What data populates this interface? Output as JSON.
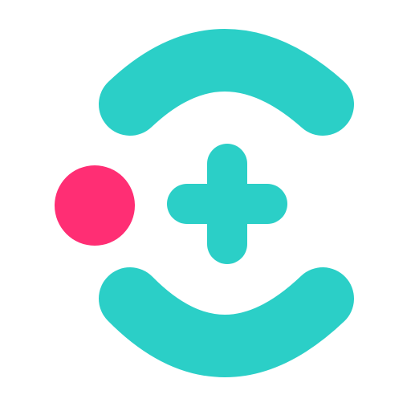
{
  "logo": {
    "name": "medical-app-logo",
    "colors": {
      "primary": "#2bcfc7",
      "accent": "#ff2e74",
      "background": "#ffffff"
    }
  }
}
